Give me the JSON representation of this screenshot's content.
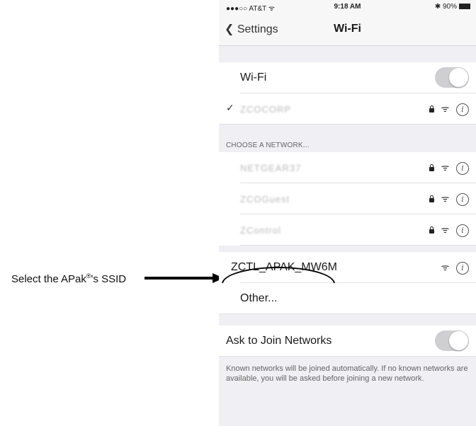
{
  "callout": {
    "text_before": "Select the APak",
    "superscript": "®",
    "text_after": "'s SSID"
  },
  "statusbar": {
    "carrier": "●●●○○ AT&T ᯤ",
    "time": "9:18 AM",
    "battery": "✱ 90%"
  },
  "navbar": {
    "back_label": "Settings",
    "title": "Wi-Fi"
  },
  "wifi_toggle": {
    "label": "Wi-Fi",
    "state": "on"
  },
  "connected_network": {
    "name": "ZCOCORP",
    "locked": true
  },
  "choose_header": "CHOOSE A NETWORK...",
  "networks": [
    {
      "name": "NETGEAR37",
      "locked": true,
      "obscured": true
    },
    {
      "name": "ZCOGuest",
      "locked": true,
      "obscured": true
    },
    {
      "name": "ZControl",
      "locked": true,
      "obscured": true
    },
    {
      "name": "ZCTL_APAK_MW6M",
      "locked": false,
      "obscured": false
    }
  ],
  "other_label": "Other...",
  "ask_to_join": {
    "label": "Ask to Join Networks",
    "state": "on"
  },
  "footer_text": "Known networks will be joined automatically. If no known networks are available, you will be asked before joining a new network.",
  "icons": {
    "checkmark": "✓",
    "info": "i",
    "wifi": "ᯤ",
    "back_chevron": "❮"
  }
}
